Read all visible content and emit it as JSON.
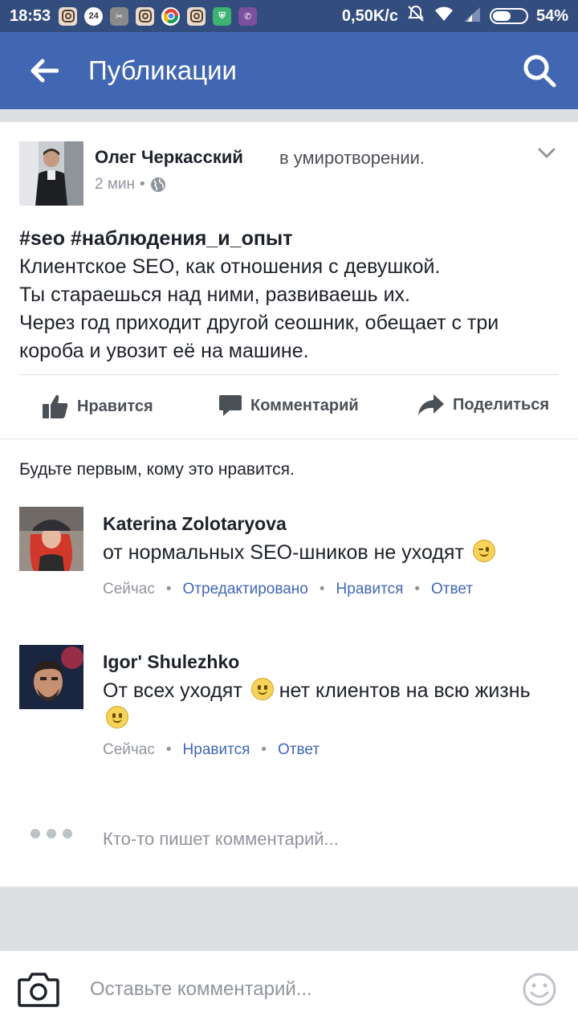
{
  "status_bar": {
    "time": "18:53",
    "net_speed": "0,50K/c",
    "battery": "54%",
    "battery_level": 0.54
  },
  "app_bar": {
    "title": "Публикации"
  },
  "post": {
    "author": "Олег Черкасский",
    "feeling": "в умиротворении.",
    "time": "2 мин",
    "tags": "#seo #наблюдения_и_опыт",
    "lines": [
      "Клиентское SEO, как отношения с девушкой.",
      "Ты стараешься над ними, развиваешь их.",
      "Через год приходит другой сеошник, обещает с три короба и увозит её на машине."
    ],
    "actions": {
      "like": "Нравится",
      "comment": "Комментарий",
      "share": "Поделиться"
    }
  },
  "first_like": "Будьте первым, кому это нравится.",
  "comments": [
    {
      "name": "Katerina Zolotaryova",
      "text": "от нормальных SEO-шников не уходят",
      "time": "Сейчас",
      "edited": "Отредактировано",
      "like": "Нравится",
      "reply": "Ответ"
    },
    {
      "name": "Igor' Shulezhko",
      "text_part1": "От всех уходят",
      "text_part2": "нет клиентов на всю жизнь",
      "time": "Сейчас",
      "like": "Нравится",
      "reply": "Ответ"
    }
  ],
  "typing": "Кто-то пишет комментарий...",
  "composer": {
    "placeholder": "Оставьте комментарий..."
  },
  "colors": {
    "brand": "#4267b2",
    "status_bar": "#344d7f",
    "muted": "#90949c"
  }
}
